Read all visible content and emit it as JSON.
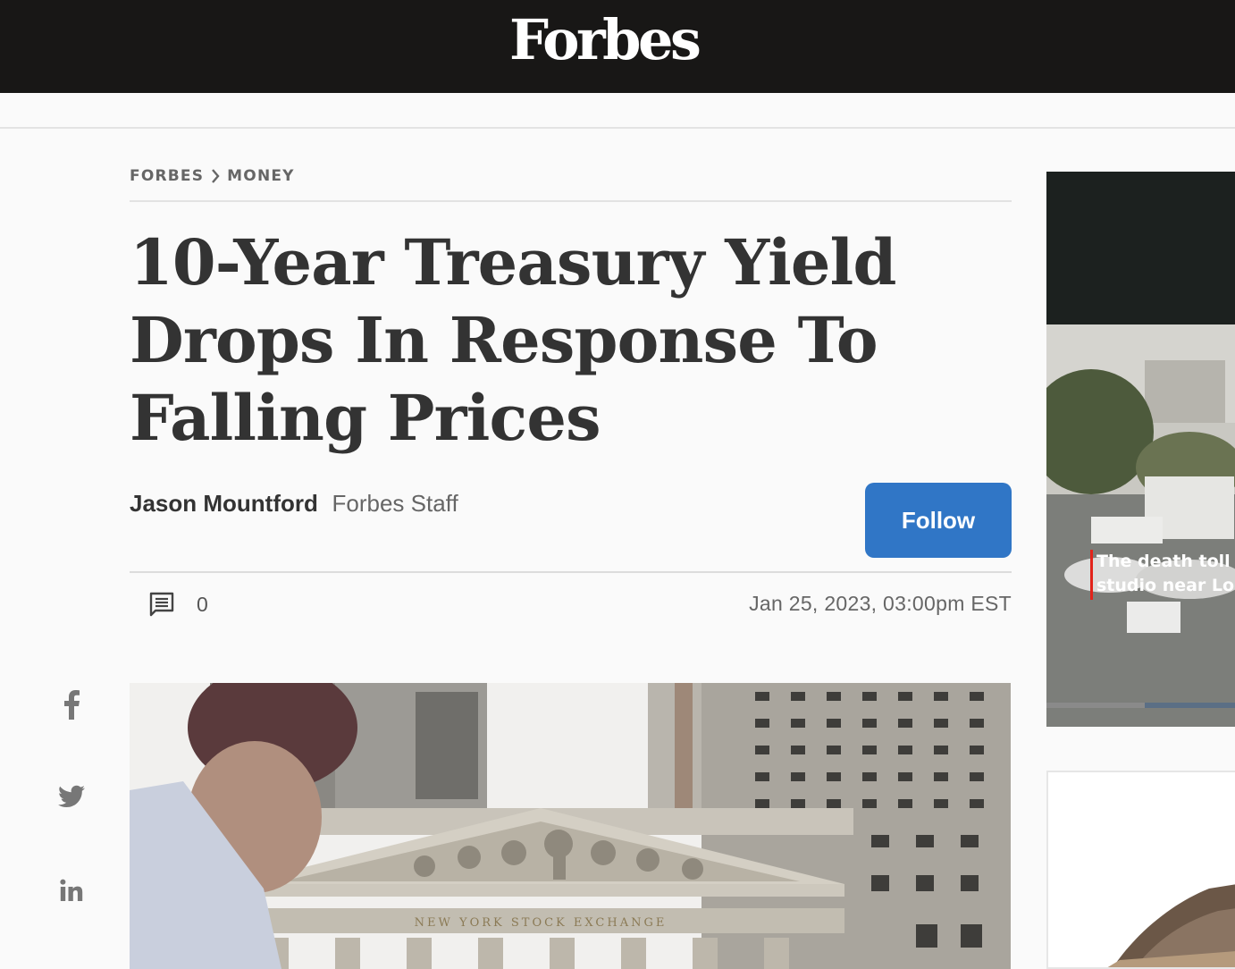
{
  "header": {
    "logo": "Forbes"
  },
  "breadcrumb": {
    "items": [
      "FORBES",
      "MONEY"
    ]
  },
  "article": {
    "title": "10-Year Treasury Yield Drops In Response To Falling Prices",
    "author_name": "Jason Mountford",
    "author_role": "Forbes Staff",
    "follow_label": "Follow",
    "comment_count": "0",
    "date": "Jan 25, 2023, 03:00pm EST",
    "hero_sign": "NEW YORK STOCK EXCHANGE"
  },
  "social": {
    "icons": [
      "facebook-icon",
      "twitter-icon",
      "linkedin-icon"
    ]
  },
  "rail": {
    "video_caption_line1": "The death toll f",
    "video_caption_line2": "studio near Los",
    "video_progress": 0.52
  },
  "colors": {
    "header_bg": "#181716",
    "accent": "#3076c6",
    "caption_bar": "#e2231a"
  }
}
